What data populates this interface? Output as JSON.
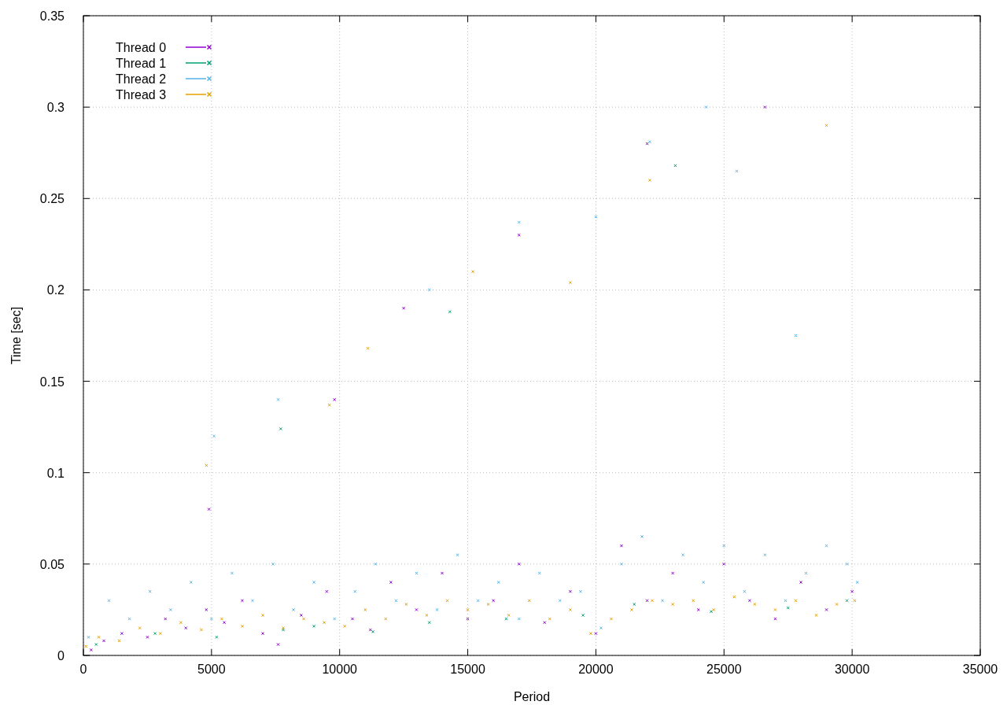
{
  "chart": {
    "chart_data": {
      "type": "scatter",
      "xlabel": "Period",
      "ylabel": "Time [sec]",
      "xlim": [
        0,
        35000
      ],
      "ylim": [
        0,
        0.35
      ],
      "xticks": [
        0,
        5000,
        10000,
        15000,
        20000,
        25000,
        30000,
        35000
      ],
      "yticks": [
        0,
        0.05,
        0.1,
        0.15,
        0.2,
        0.25,
        0.3,
        0.35
      ],
      "grid": true,
      "legend": "top-left",
      "series": [
        {
          "name": "Thread 0",
          "color": "#9400d3",
          "x": [
            300,
            800,
            1500,
            2500,
            3200,
            4000,
            4800,
            5500,
            6200,
            7000,
            7600,
            8500,
            9500,
            10500,
            11200,
            12000,
            13000,
            14000,
            15000,
            16000,
            17000,
            18000,
            19000,
            20000,
            21000,
            22000,
            23000,
            24000,
            25000,
            26000,
            27000,
            28000,
            29000,
            30000,
            4900,
            12500,
            17000,
            22000,
            26600,
            9800
          ],
          "values": [
            0.003,
            0.008,
            0.012,
            0.01,
            0.02,
            0.015,
            0.025,
            0.018,
            0.03,
            0.012,
            0.006,
            0.022,
            0.035,
            0.02,
            0.014,
            0.04,
            0.025,
            0.045,
            0.02,
            0.03,
            0.05,
            0.018,
            0.035,
            0.012,
            0.06,
            0.03,
            0.045,
            0.025,
            0.05,
            0.03,
            0.02,
            0.04,
            0.025,
            0.035,
            0.08,
            0.19,
            0.23,
            0.28,
            0.3,
            0.14
          ]
        },
        {
          "name": "Thread 1",
          "color": "#009e73",
          "x": [
            500,
            2800,
            5200,
            7800,
            9000,
            11300,
            13500,
            16500,
            19500,
            21500,
            24500,
            27500,
            29800,
            7700,
            14300,
            23100
          ],
          "values": [
            0.006,
            0.012,
            0.01,
            0.014,
            0.016,
            0.013,
            0.018,
            0.02,
            0.022,
            0.028,
            0.024,
            0.026,
            0.03,
            0.124,
            0.188,
            0.268
          ]
        },
        {
          "name": "Thread 2",
          "color": "#56b4e9",
          "x": [
            200,
            1000,
            1800,
            2600,
            3400,
            4200,
            5000,
            5800,
            6600,
            7400,
            8200,
            9000,
            9800,
            10600,
            11400,
            12200,
            13000,
            13800,
            14600,
            15400,
            16200,
            17000,
            17800,
            18600,
            19400,
            20200,
            21000,
            21800,
            22600,
            23400,
            24200,
            25000,
            25800,
            26600,
            27400,
            28200,
            29000,
            29800,
            30200,
            5100,
            7600,
            13500,
            17000,
            20000,
            22100,
            24300,
            27800,
            25500
          ],
          "values": [
            0.01,
            0.03,
            0.02,
            0.035,
            0.025,
            0.04,
            0.02,
            0.045,
            0.03,
            0.05,
            0.025,
            0.04,
            0.02,
            0.035,
            0.05,
            0.03,
            0.045,
            0.025,
            0.055,
            0.03,
            0.04,
            0.02,
            0.045,
            0.03,
            0.035,
            0.015,
            0.05,
            0.065,
            0.03,
            0.055,
            0.04,
            0.06,
            0.035,
            0.055,
            0.03,
            0.045,
            0.06,
            0.05,
            0.04,
            0.12,
            0.14,
            0.2,
            0.237,
            0.24,
            0.281,
            0.3,
            0.175,
            0.265
          ]
        },
        {
          "name": "Thread 3",
          "color": "#e69f00",
          "x": [
            100,
            600,
            1400,
            2200,
            3000,
            3800,
            4600,
            5400,
            6200,
            7000,
            7800,
            8600,
            9400,
            10200,
            11000,
            11800,
            12600,
            13400,
            14200,
            15000,
            15800,
            16600,
            17400,
            18200,
            19000,
            19800,
            20600,
            21400,
            22200,
            23000,
            23800,
            24600,
            25400,
            26200,
            27000,
            27800,
            28600,
            29400,
            30100,
            4800,
            9600,
            11100,
            15200,
            19000,
            22100,
            29000
          ],
          "values": [
            0.005,
            0.01,
            0.008,
            0.015,
            0.012,
            0.018,
            0.014,
            0.02,
            0.016,
            0.022,
            0.015,
            0.02,
            0.018,
            0.016,
            0.025,
            0.02,
            0.028,
            0.022,
            0.03,
            0.025,
            0.028,
            0.022,
            0.03,
            0.02,
            0.025,
            0.012,
            0.02,
            0.025,
            0.03,
            0.028,
            0.03,
            0.025,
            0.032,
            0.028,
            0.025,
            0.03,
            0.022,
            0.028,
            0.03,
            0.104,
            0.137,
            0.168,
            0.21,
            0.204,
            0.26,
            0.29
          ]
        }
      ]
    }
  }
}
